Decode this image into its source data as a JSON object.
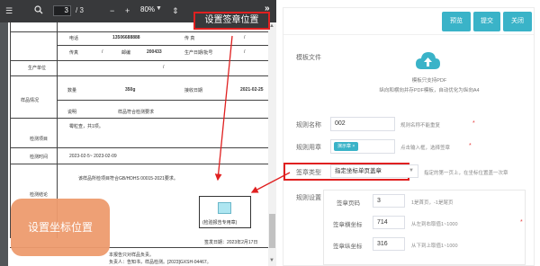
{
  "viewer": {
    "page_current": "3",
    "page_total": "/ 3",
    "zoom": "80%",
    "zoom_minus": "−",
    "zoom_plus": "+",
    "set_position_button": "设置签章位置",
    "more": "»"
  },
  "document": {
    "rows": [
      {
        "c1": "电话",
        "c2": "13506688888",
        "c3": "传 真",
        "c4": "/"
      },
      {
        "c1": "传真",
        "c2": "/",
        "c2b": "邮编",
        "c2c": "200433",
        "c3": "生产日期/批号",
        "c4": "/"
      },
      {
        "c1": "生产单位",
        "c4": "/"
      },
      {
        "c1": "数量",
        "c2": "350g",
        "c3": "接收日期",
        "c4": "2021-02-25"
      },
      {
        "c1": "说明",
        "c2": "样品符合检测要求"
      }
    ],
    "sample_group": "样品情况",
    "check_item_label": "检测项目",
    "check_item_value": "霉粒查，共1项。",
    "check_time_label": "检测时间",
    "check_time_value": "2023-02-5~ 2023-02-09",
    "check_conclusion_label": "检测结论",
    "conclusion_text": "该样品所检项目符合GB/HDHS 00015-2021要求。",
    "stamp_label": "(检验报告专用章)",
    "sign_date": "签发日期：2023年2月17日",
    "note1": "本报告只对样品负责。",
    "note2": "负责人：告知书，样品检测。[2023]GXSH-04467。"
  },
  "callout": {
    "text": "设置坐标位置"
  },
  "panel": {
    "buttons": {
      "preview": "预览",
      "submit": "提交",
      "close": "关闭"
    },
    "template_label": "模板文件",
    "upload_line1": "模板只支持PDF",
    "upload_line2": "纵向和横向并存PDF模板，自动优化为纵向A4",
    "rule_name_label": "规则名称",
    "rule_name_value": "002",
    "rule_name_hint": "规则名称不能重复",
    "rule_seal_label": "规则用章",
    "rule_seal_tag": "演示章",
    "rule_seal_tag_close": "×",
    "rule_seal_hint": "点击输入框，选择签章",
    "seal_type_label": "签章类型",
    "seal_type_value": "指定坐标单页盖章",
    "seal_type_hint": "指定的第一页上，在坐标位置盖一次章",
    "rule_setting_label": "规则设置",
    "seal_page_label": "签章页码",
    "seal_page_value": "3",
    "seal_page_hint": "1是首页，-1是尾页",
    "seal_x_label": "签章横坐标",
    "seal_x_value": "714",
    "seal_x_hint": "从左到右取值1~1000",
    "seal_y_label": "签章纵坐标",
    "seal_y_value": "316",
    "seal_y_hint": "从下到上取值1~1000",
    "required_mark": "*"
  },
  "colors": {
    "accent": "#3ab3c8",
    "highlight_red": "#e02020",
    "callout": "#ee9b6e",
    "viewer_bg": "#525659",
    "toolbar_bg": "#38393b"
  }
}
